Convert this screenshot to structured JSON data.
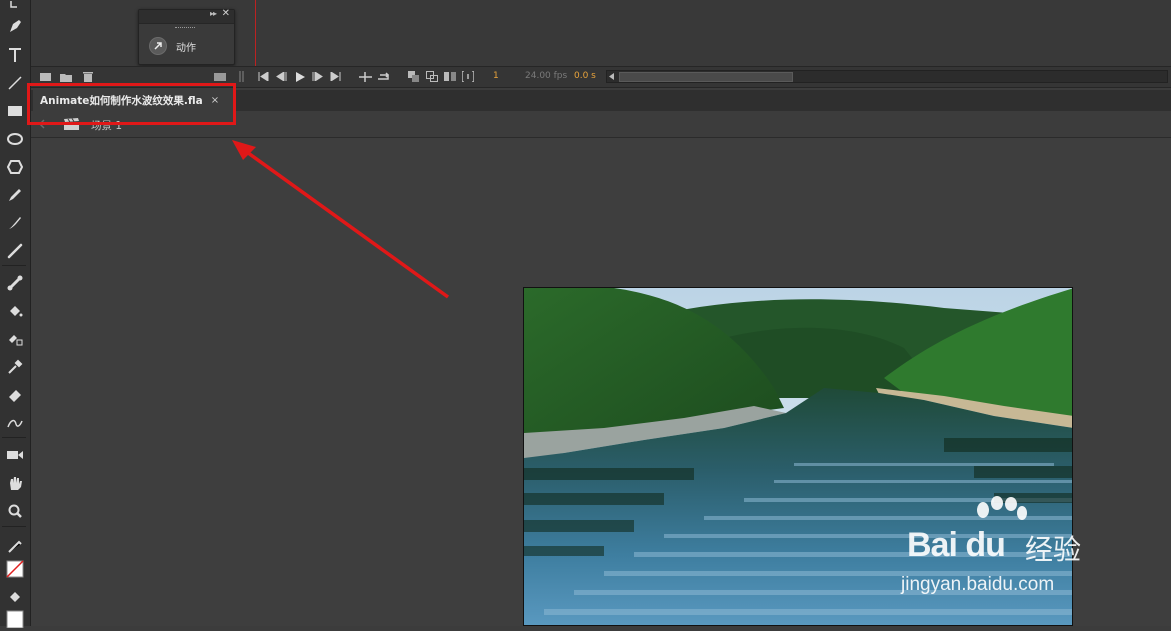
{
  "app": {
    "name": "Animate"
  },
  "motion_popup": {
    "label": "动作",
    "icon": "motion-preset-icon"
  },
  "timeline": {
    "current_frame": "1",
    "fps": "24.00 fps",
    "elapsed": "0.0 s"
  },
  "document_tab": {
    "label": "Animate如何制作水波纹效果.fla",
    "close": "×"
  },
  "edit_bar": {
    "scene_label": "场景 1"
  },
  "watermark": {
    "logo": "Bai du",
    "logo_cn": "经验",
    "url": "jingyan.baidu.com"
  },
  "annotation": {
    "highlight_color": "#e01818"
  }
}
